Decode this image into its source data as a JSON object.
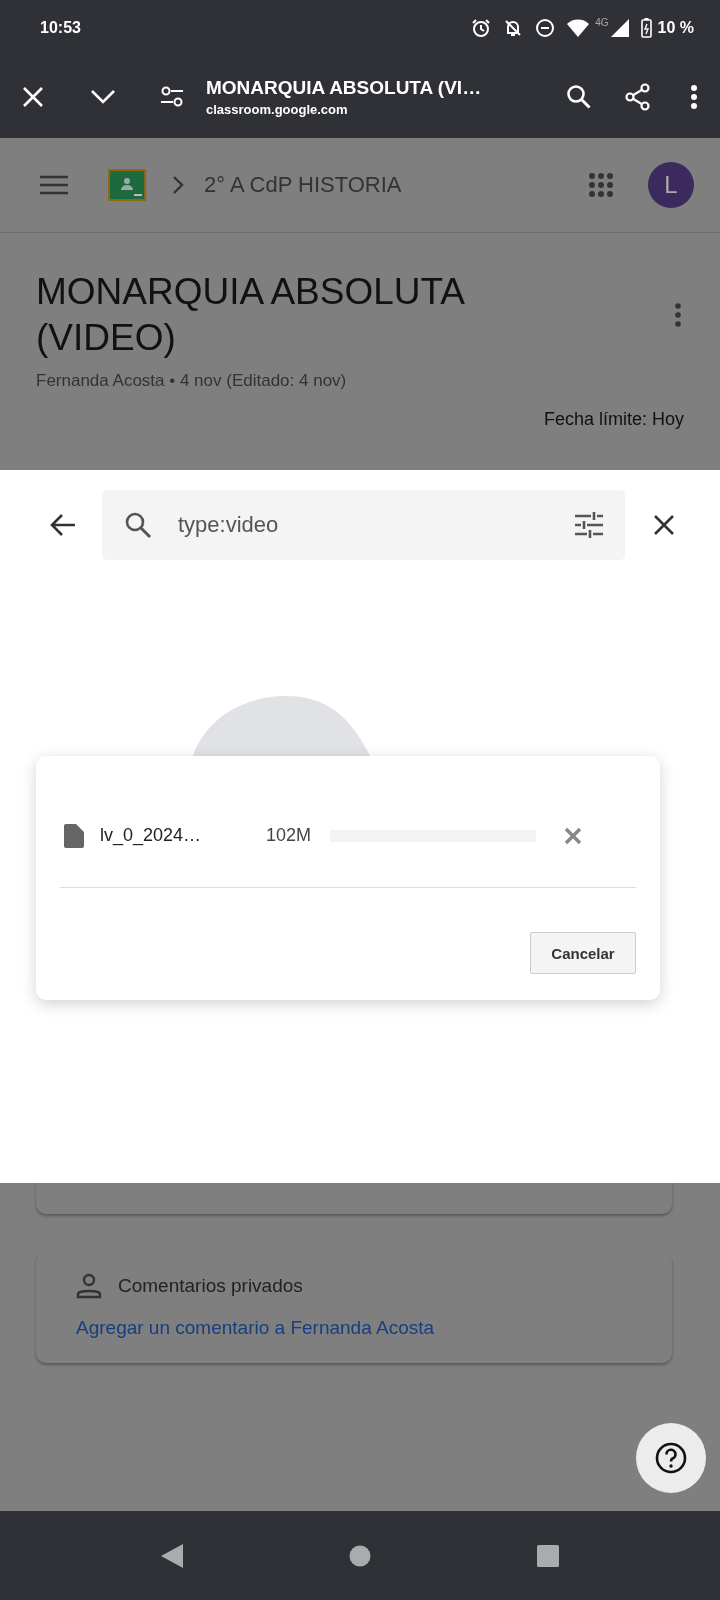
{
  "status_bar": {
    "time": "10:53",
    "network": "4G",
    "battery": "10 %"
  },
  "browser": {
    "title": "MONARQUIA ABSOLUTA (VI…",
    "url": "classroom.google.com"
  },
  "class_header": {
    "breadcrumb": "2° A CdP HISTORIA",
    "avatar": "L"
  },
  "assignment": {
    "title": "MONARQUIA ABSOLUTA (VIDEO)",
    "meta": "Fernanda Acosta • 4 nov (Editado: 4 nov)",
    "due": "Fecha límite: Hoy"
  },
  "picker": {
    "search_value": "type:video"
  },
  "upload_dialog": {
    "file_name": "lv_0_2024…",
    "size": "102M",
    "level": 0,
    "button": "Cancelar"
  },
  "private_comments": {
    "title": "Comentarios privados",
    "link": "Agregar un comentario a Fernanda Acosta"
  }
}
